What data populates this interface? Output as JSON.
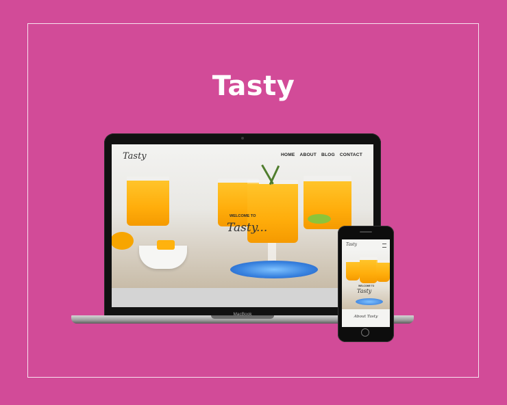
{
  "page": {
    "heading": "Tasty",
    "background_color": "#d24b98"
  },
  "laptop": {
    "brand": "MacBook",
    "site": {
      "logo": "Tasty",
      "nav": [
        "HOME",
        "ABOUT",
        "BLOG",
        "CONTACT"
      ],
      "welcome": "WELCOME TO",
      "tagline": "Tasty..."
    }
  },
  "phone": {
    "site": {
      "logo": "Tasty",
      "welcome": "WELCOME TO",
      "tagline": "Tasty",
      "about_heading": "About Tasty"
    }
  }
}
